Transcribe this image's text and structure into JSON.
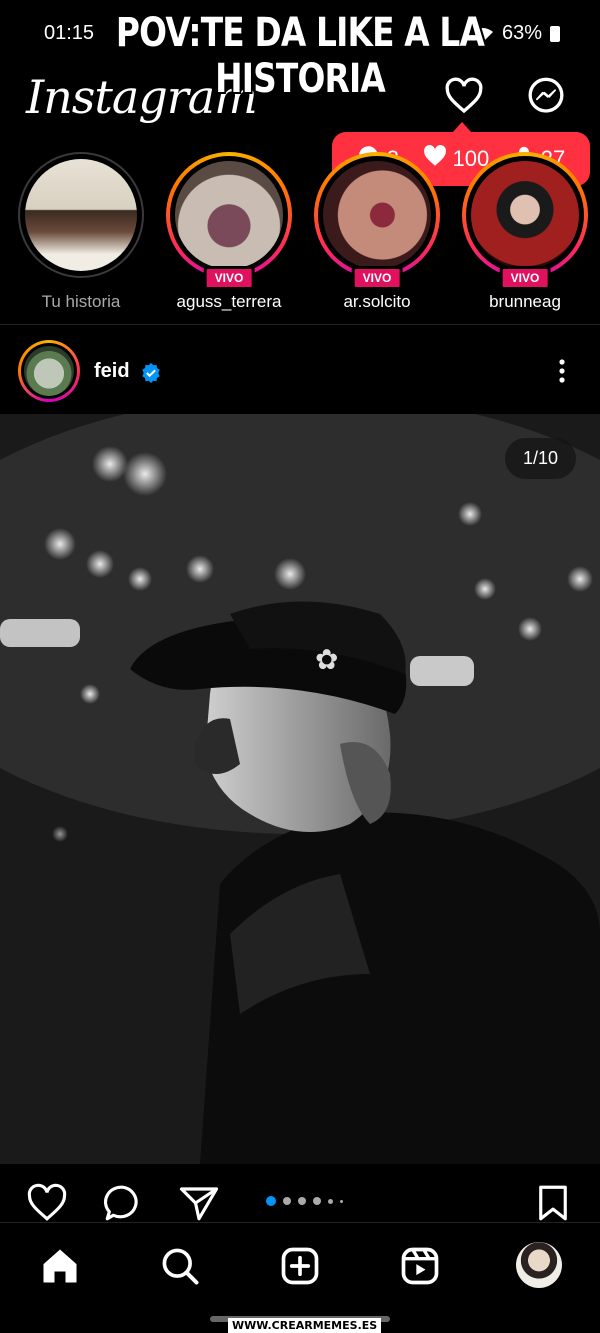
{
  "status": {
    "time": "01:15",
    "battery": "63%"
  },
  "meme": {
    "line1": "POV:TE DA LIKE A LA",
    "line2": "HISTORIA"
  },
  "header": {
    "logo": "Instagram"
  },
  "notifications": {
    "comments": "3",
    "likes": "100",
    "followers": "27"
  },
  "stories": [
    {
      "label": "Tu historia",
      "live": false
    },
    {
      "label": "aguss_terrera",
      "live": true
    },
    {
      "label": "ar.solcito",
      "live": true
    },
    {
      "label": "brunneag",
      "live": true
    }
  ],
  "live_badge": "VIVO",
  "post": {
    "username": "feid",
    "counter": "1/10"
  },
  "carousel": {
    "total": 10,
    "current": 1
  },
  "colors": {
    "accent": "#ff3040",
    "live": "#e0115f",
    "verified": "#0095f6"
  },
  "watermark": "WWW.CREARMEMES.ES"
}
